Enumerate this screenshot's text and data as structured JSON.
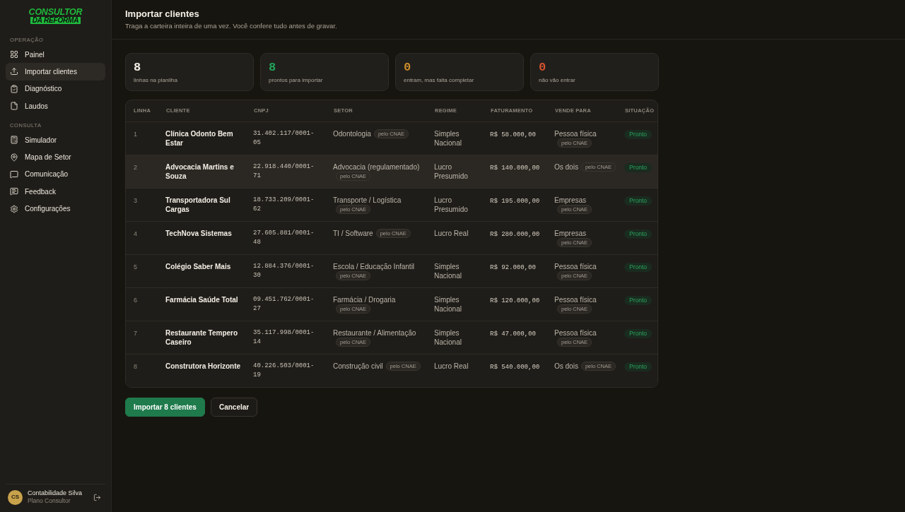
{
  "sidebar": {
    "logo": {
      "line_1": "CONSULTOR",
      "line_2": "DA REFORMA"
    },
    "sections": [
      {
        "label": "OPERAÇÃO",
        "items": [
          {
            "label": "Painel",
            "selected": false
          },
          {
            "label": "Importar clientes",
            "selected": true
          },
          {
            "label": "Diagnóstico",
            "selected": false
          },
          {
            "label": "Laudos",
            "selected": false
          }
        ]
      },
      {
        "label": "CONSULTA",
        "items": [
          {
            "label": "Simulador",
            "selected": false
          },
          {
            "label": "Mapa de Setor",
            "selected": false
          },
          {
            "label": "Comunicação",
            "selected": false
          },
          {
            "label": "Feedback",
            "selected": false
          },
          {
            "label": "Configurações",
            "selected": false
          }
        ]
      }
    ],
    "user": {
      "initials": "CS",
      "name": "Contabilidade Silva",
      "plan": "Plano Consultor"
    }
  },
  "header": {
    "title": "Importar clientes",
    "subtitle": "Traga a carteira inteira de uma vez. Você confere tudo antes de gravar."
  },
  "stats": [
    {
      "value": "8",
      "label": "linhas na planilha",
      "color": "#f4efe6"
    },
    {
      "value": "8",
      "label": "prontos para importar",
      "color": "#22a35a"
    },
    {
      "value": "0",
      "label": "entram, mas falta completar",
      "color": "#c98a2b"
    },
    {
      "value": "0",
      "label": "não vão entrar",
      "color": "#d4522f"
    }
  ],
  "table": {
    "columns": [
      "LINHA",
      "CLIENTE",
      "CNPJ",
      "SETOR",
      "REGIME",
      "FATURAMENTO",
      "VENDE PARA",
      "SITUAÇÃO"
    ],
    "rows": [
      {
        "line": "1",
        "client": "Clínica Odonto Bem Estar",
        "cnpj": "31.402.117/0001-05",
        "sector": {
          "text": "Odontologia",
          "tag": "pelo CNAE"
        },
        "regime": "Simples Nacional",
        "revenue": "R$ 58.000,00",
        "sells_to": {
          "text": "Pessoa física",
          "tag": "pelo CNAE"
        },
        "status": "Pronto",
        "selected": false
      },
      {
        "line": "2",
        "client": "Advocacia Martins e Souza",
        "cnpj": "22.918.440/0001-71",
        "sector": {
          "text": "Advocacia (regulamentado)",
          "tag": "pelo CNAE"
        },
        "regime": "Lucro Presumido",
        "revenue": "R$ 140.000,00",
        "sells_to": {
          "text": "Os dois",
          "tag": "pelo CNAE"
        },
        "status": "Pronto",
        "selected": true
      },
      {
        "line": "3",
        "client": "Transportadora Sul Cargas",
        "cnpj": "18.733.209/0001-62",
        "sector": {
          "text": "Transporte / Logística",
          "tag": "pelo CNAE"
        },
        "regime": "Lucro Presumido",
        "revenue": "R$ 195.000,00",
        "sells_to": {
          "text": "Empresas",
          "tag": "pelo CNAE"
        },
        "status": "Pronto",
        "selected": false
      },
      {
        "line": "4",
        "client": "TechNova Sistemas",
        "cnpj": "27.605.881/0001-48",
        "sector": {
          "text": "TI / Software",
          "tag": "pelo CNAE"
        },
        "regime": "Lucro Real",
        "revenue": "R$ 280.000,00",
        "sells_to": {
          "text": "Empresas",
          "tag": "pelo CNAE"
        },
        "status": "Pronto",
        "selected": false
      },
      {
        "line": "5",
        "client": "Colégio Saber Mais",
        "cnpj": "12.884.376/0001-30",
        "sector": {
          "text": "Escola / Educação Infantil",
          "tag": "pelo CNAE"
        },
        "regime": "Simples Nacional",
        "revenue": "R$ 92.000,00",
        "sells_to": {
          "text": "Pessoa física",
          "tag": "pelo CNAE"
        },
        "status": "Pronto",
        "selected": false
      },
      {
        "line": "6",
        "client": "Farmácia Saúde Total",
        "cnpj": "09.451.762/0001-27",
        "sector": {
          "text": "Farmácia / Drogaria",
          "tag": "pelo CNAE"
        },
        "regime": "Simples Nacional",
        "revenue": "R$ 120.000,00",
        "sells_to": {
          "text": "Pessoa física",
          "tag": "pelo CNAE"
        },
        "status": "Pronto",
        "selected": false
      },
      {
        "line": "7",
        "client": "Restaurante Tempero Caseiro",
        "cnpj": "35.117.998/0001-14",
        "sector": {
          "text": "Restaurante / Alimentação",
          "tag": "pelo CNAE"
        },
        "regime": "Simples Nacional",
        "revenue": "R$ 47.000,00",
        "sells_to": {
          "text": "Pessoa física",
          "tag": "pelo CNAE"
        },
        "status": "Pronto",
        "selected": false
      },
      {
        "line": "8",
        "client": "Construtora Horizonte",
        "cnpj": "40.226.503/0001-19",
        "sector": {
          "text": "Construção civil",
          "tag": "pelo CNAE"
        },
        "regime": "Lucro Real",
        "revenue": "R$ 540.000,00",
        "sells_to": {
          "text": "Os dois",
          "tag": "pelo CNAE"
        },
        "status": "Pronto",
        "selected": false
      }
    ]
  },
  "actions": [
    {
      "label": "Importar 8 clientes",
      "kind": "primary"
    },
    {
      "label": "Cancelar",
      "kind": "secondary"
    }
  ]
}
